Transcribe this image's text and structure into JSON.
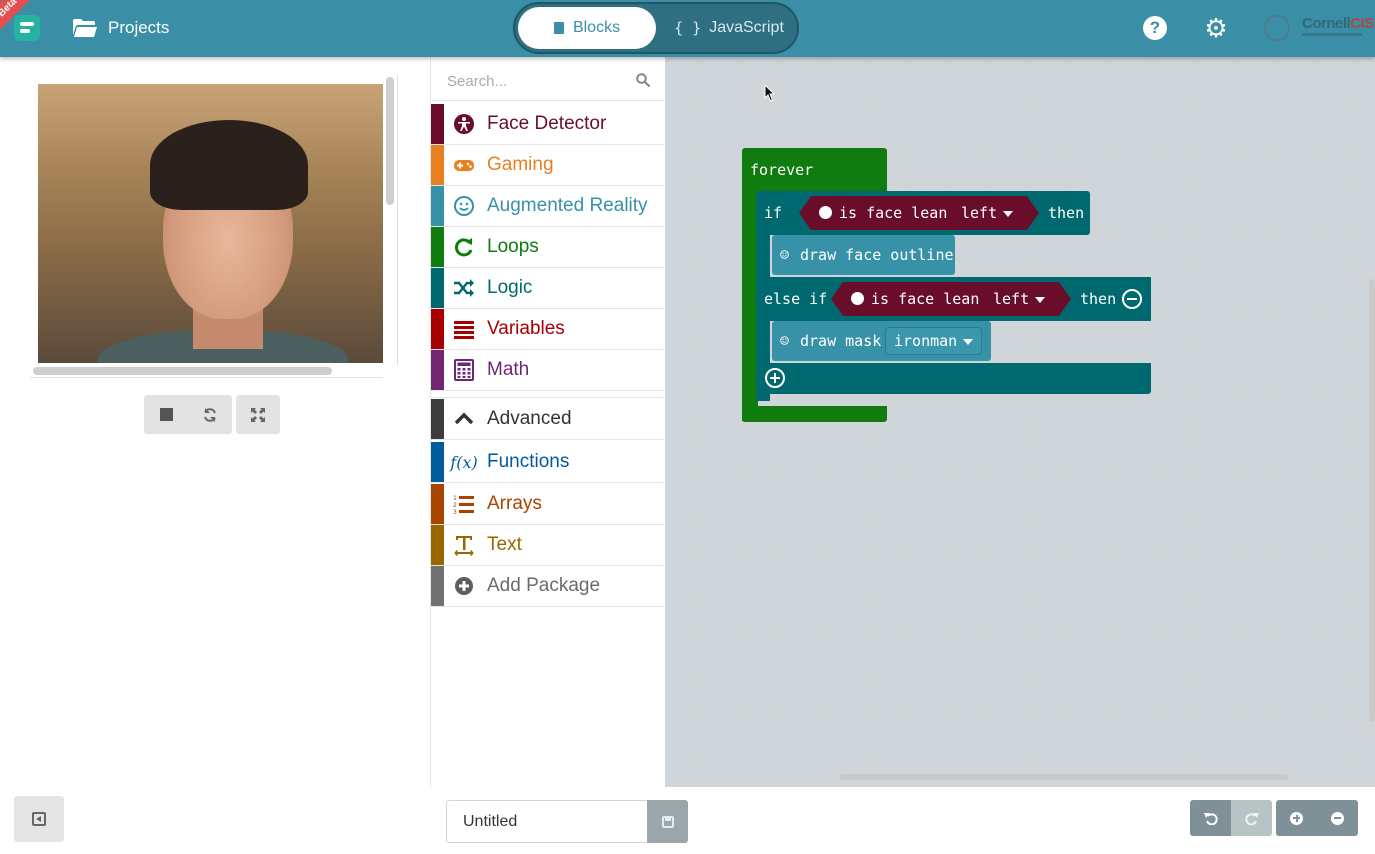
{
  "header": {
    "beta_label": "Beta",
    "projects_label": "Projects",
    "mode_blocks_label": "Blocks",
    "mode_js_label": "JavaScript",
    "brand_name": "Cornell",
    "brand_suffix": "CIS",
    "accent_color": "#3a8ea5"
  },
  "simulator": {
    "controls": [
      "stop-icon",
      "restart-icon",
      "fullscreen-icon"
    ]
  },
  "toolbox": {
    "search_placeholder": "Search...",
    "categories": [
      {
        "label": "Face Detector",
        "color": "#6a0d2b",
        "icon": "face-detector-icon"
      },
      {
        "label": "Gaming",
        "color": "#e8801f",
        "icon": "gamepad-icon"
      },
      {
        "label": "Augmented Reality",
        "color": "#3792a8",
        "icon": "smiley-icon"
      },
      {
        "label": "Loops",
        "color": "#107c10",
        "icon": "loop-icon"
      },
      {
        "label": "Logic",
        "color": "#006970",
        "icon": "shuffle-icon"
      },
      {
        "label": "Variables",
        "color": "#a80000",
        "icon": "list-lines-icon"
      },
      {
        "label": "Math",
        "color": "#712672",
        "icon": "calculator-icon"
      }
    ],
    "advanced": [
      {
        "label": "Advanced",
        "color": "#3c3c3c",
        "icon": "chevron-up-icon"
      },
      {
        "label": "Functions",
        "color": "#005a9e",
        "icon": "function-icon"
      },
      {
        "label": "Arrays",
        "color": "#a94400",
        "icon": "numbered-list-icon"
      },
      {
        "label": "Text",
        "color": "#996600",
        "icon": "text-icon"
      },
      {
        "label": "Add Package",
        "color": "#717171",
        "icon": "plus-circle-icon"
      }
    ]
  },
  "workspace": {
    "forever_label": "forever",
    "if_label": "if",
    "is_face_lean_label": "is face lean",
    "if_direction": "left",
    "then_label": "then",
    "draw_face_outline_label": "draw face outline",
    "else_if_label": "else if",
    "elseif_direction": "left",
    "draw_mask_label": "draw mask",
    "mask_value": "ironman"
  },
  "footer": {
    "project_name": "Untitled"
  }
}
